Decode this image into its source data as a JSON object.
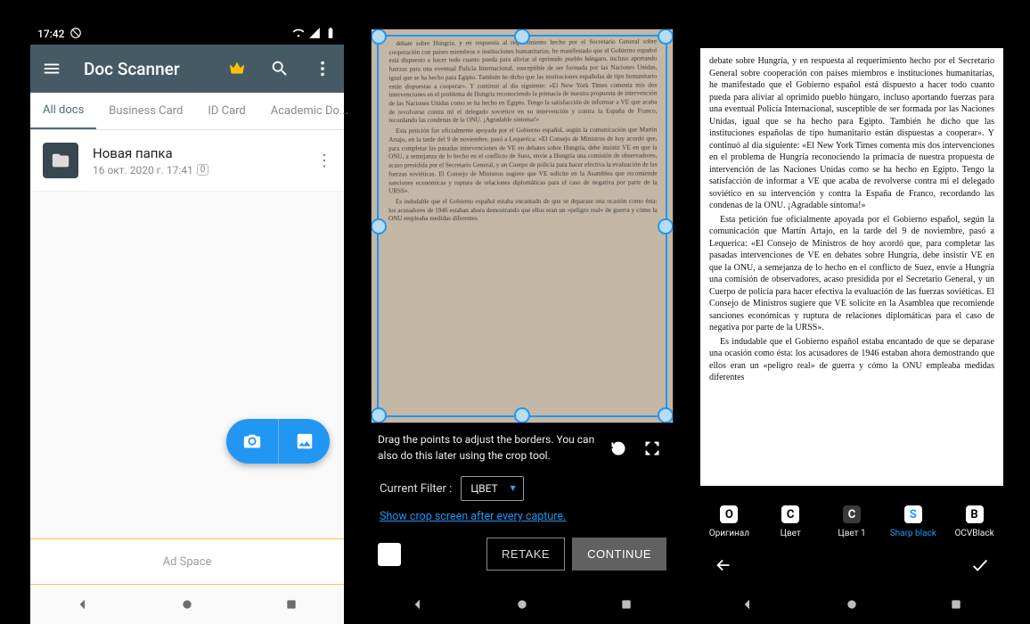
{
  "statusbar": {
    "time": "17:42"
  },
  "appbar": {
    "title": "Doc Scanner"
  },
  "tabs": [
    "All docs",
    "Business Card",
    "ID Card",
    "Academic Do..."
  ],
  "folder": {
    "name": "Новая папка",
    "subtitle": "16 окт. 2020 г. 17:41",
    "count": "0"
  },
  "adspace": "Ad Space",
  "crop": {
    "hint": "Drag the points to adjust the borders. You can also do this later using the crop tool.",
    "filter_label": "Current Filter :",
    "filter_value": "ЦВЕТ",
    "link": "Show crop screen after every capture.",
    "retake": "RETAKE",
    "continue": "CONTINUE"
  },
  "filters": [
    {
      "code": "O",
      "label": "Оригинал"
    },
    {
      "code": "C",
      "label": "Цвет"
    },
    {
      "code": "C",
      "label": "Цвет 1"
    },
    {
      "code": "S",
      "label": "Sharp black"
    },
    {
      "code": "B",
      "label": "OCVBlack"
    }
  ],
  "document_text": {
    "p1": "debate sobre Hungría, y en respuesta al requerimiento hecho por el Secretario General sobre cooperación con países miembros e instituciones humanitarias, he manifestado que el Gobierno español está dispuesto a hacer todo cuanto pueda para aliviar al oprimido pueblo húngaro, incluso aportando fuerzas para una eventual Policía Internacional, susceptible de ser formada por las Naciones Unidas, igual que se ha hecho para Egipto. También he dicho que las instituciones españolas de tipo humanitario están dispuestas a cooperar». Y continuó al día siguiente: «El New York Times comenta mis dos intervenciones en el problema de Hungría reconociendo la primacía de nuestra propuesta de intervención de las Naciones Unidas como se ha hecho en Egipto. Tengo la satisfacción de informar a VE que acaba de revolverse contra mí el delegado soviético en su intervención y contra la España de Franco, recordando las condenas de la ONU. ¡Agradable síntoma!»",
    "p2": "Esta petición fue oficialmente apoyada por el Gobierno español, según la comunicación que Martín Artajo, en la tarde del 9 de noviembre, pasó a Lequerica: «El Consejo de Ministros de hoy acordó que, para completar las pasadas intervenciones de VE en debates sobre Hungría, debe insistir VE en que la ONU, a semejanza de lo hecho en el conflicto de Suez, envíe a Hungría una comisión de observadores, acaso presidida por el Secretario General, y un Cuerpo de policía para hacer efectiva la evaluación de las fuerzas soviéticas. El Consejo de Ministros sugiere que VE solicite en la Asamblea que recomiende sanciones económicas y ruptura de relaciones diplomáticas para el caso de negativa por parte de la URSS».",
    "p3": "Es indudable que el Gobierno español estaba encantado de que se deparase una ocasión como ésta: los acusadores de 1946 estaban ahora demostrando que ellos eran un «peligro real» de guerra y cómo la ONU empleaba medidas diferentes"
  }
}
